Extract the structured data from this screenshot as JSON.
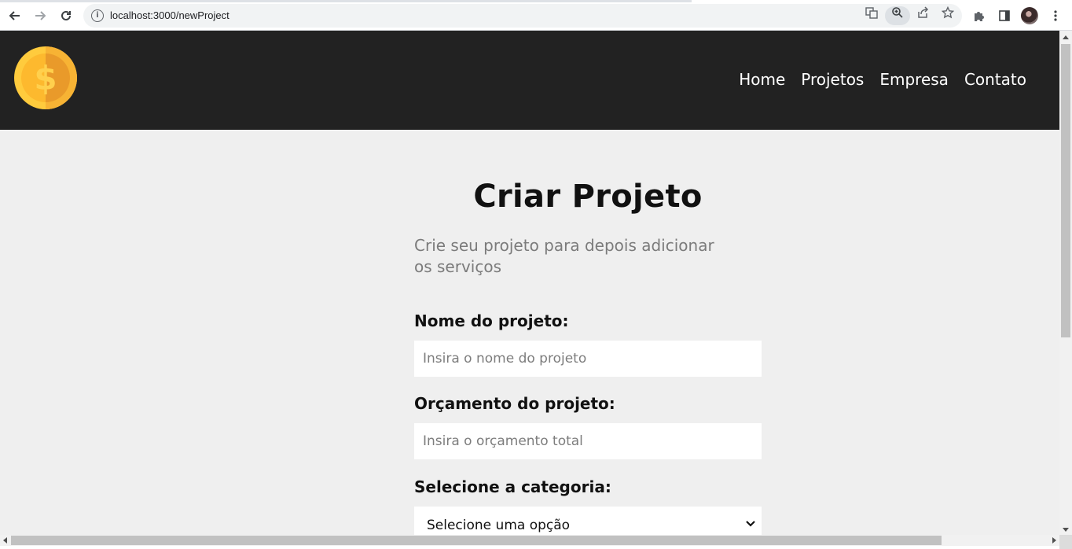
{
  "browser": {
    "url": "localhost:3000/newProject"
  },
  "nav": {
    "items": [
      {
        "label": "Home"
      },
      {
        "label": "Projetos"
      },
      {
        "label": "Empresa"
      },
      {
        "label": "Contato"
      }
    ]
  },
  "form": {
    "title": "Criar Projeto",
    "subtitle": "Crie seu projeto para depois adicionar os serviços",
    "name_label": "Nome do projeto:",
    "name_placeholder": "Insira o nome do projeto",
    "budget_label": "Orçamento do projeto:",
    "budget_placeholder": "Insira o orçamento total",
    "category_label": "Selecione a categoria:",
    "category_selected": "Selecione uma opção"
  },
  "colors": {
    "header_bg": "#222222",
    "page_bg": "#efefef",
    "logo_gold": "#ffbb33"
  }
}
